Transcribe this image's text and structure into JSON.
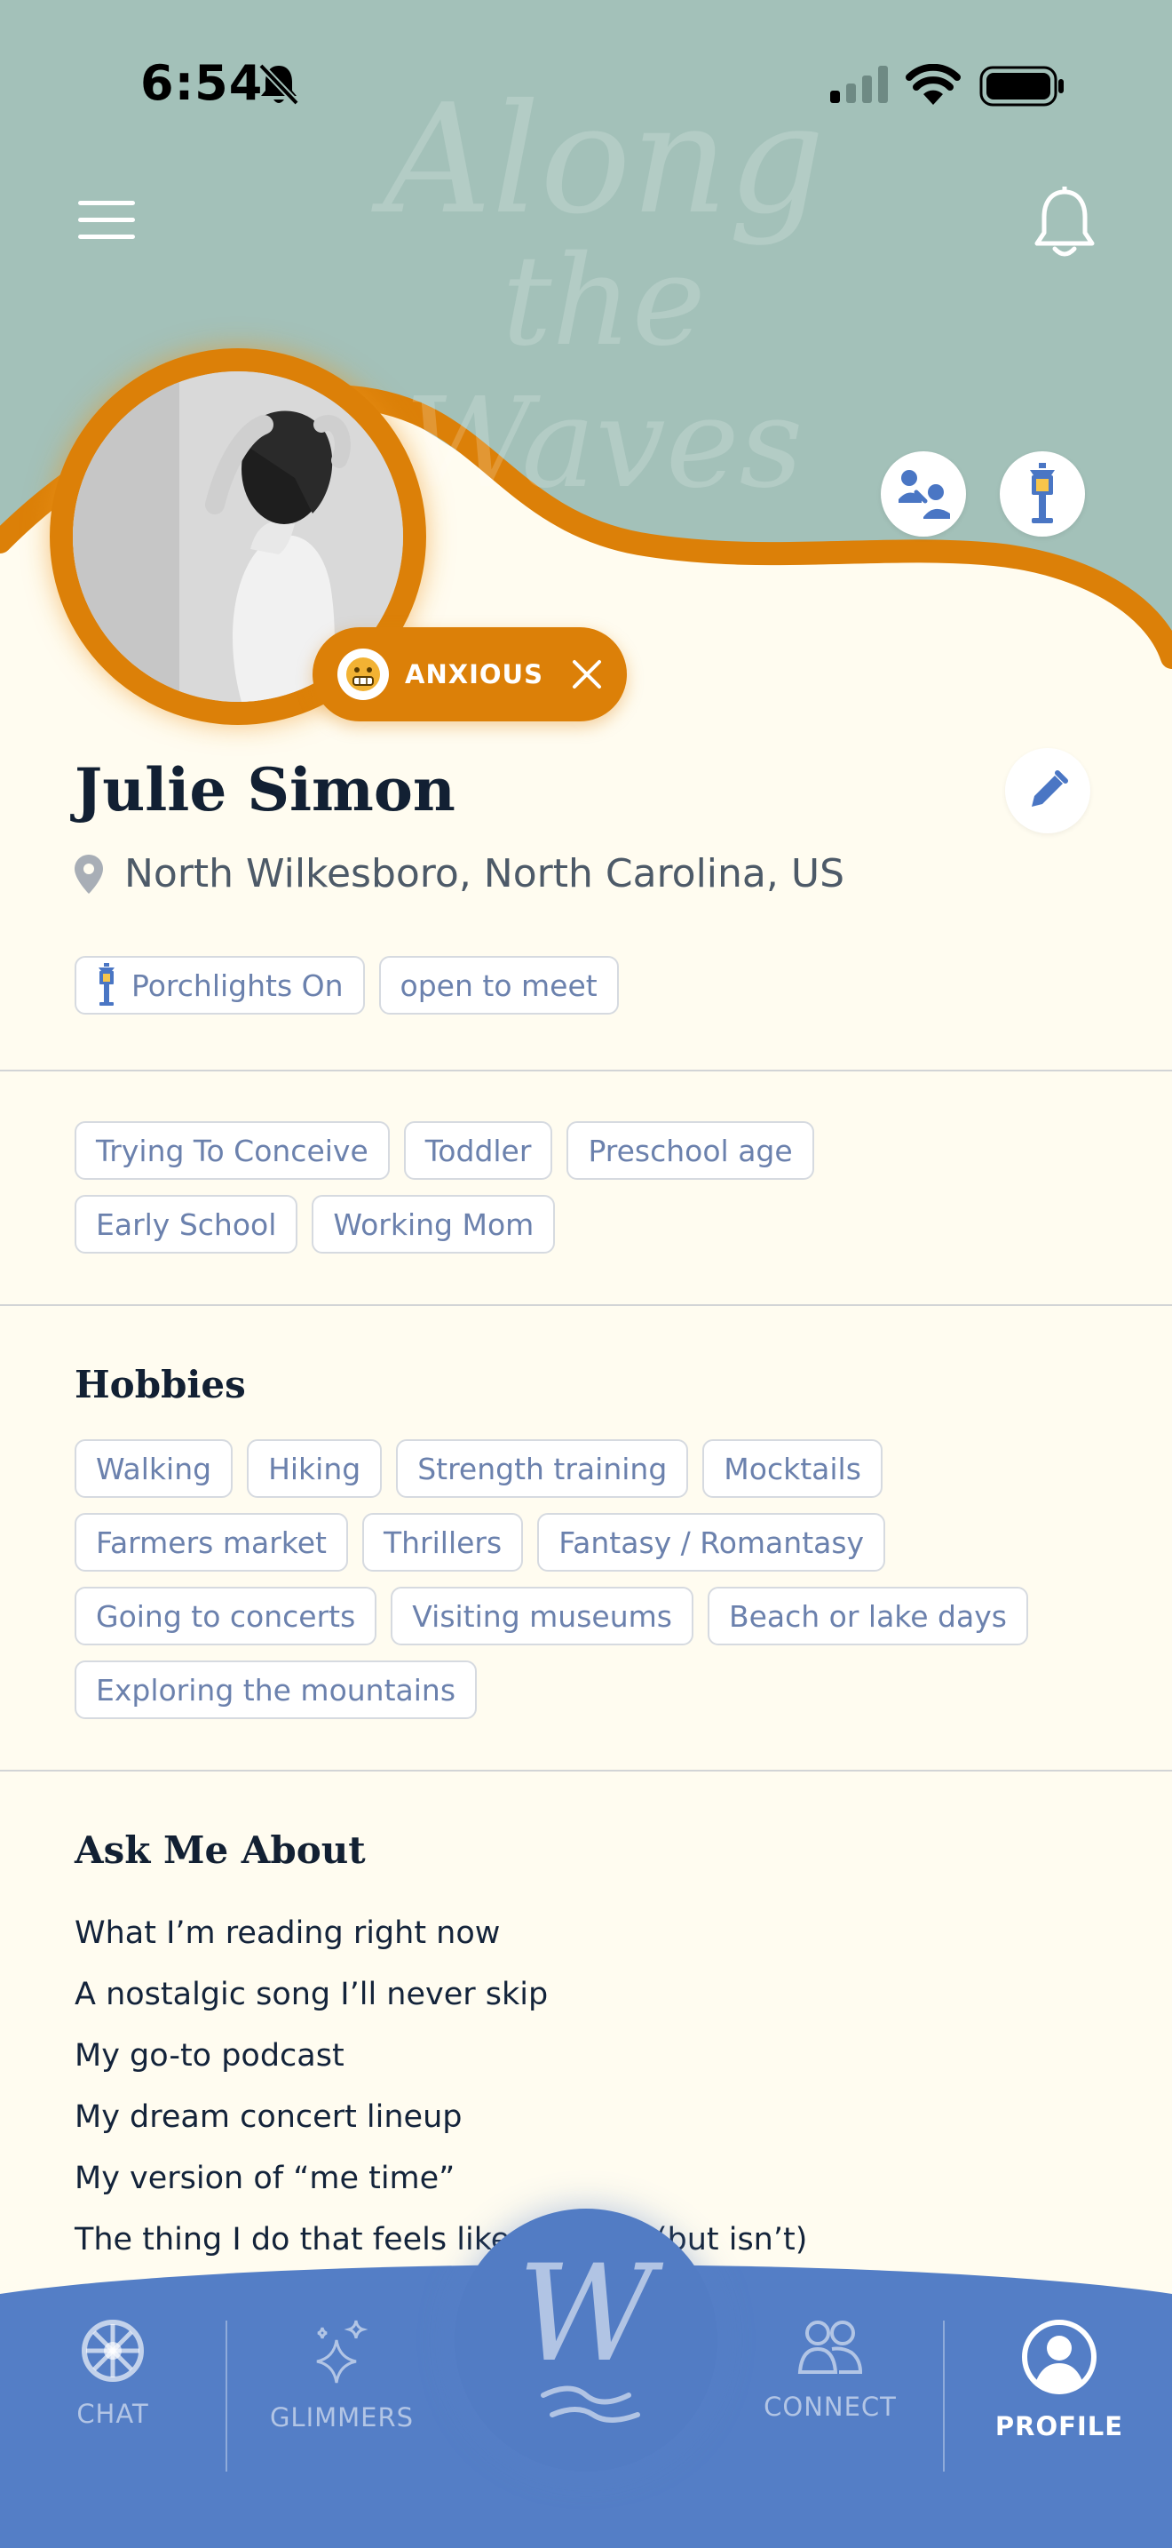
{
  "status_bar": {
    "time": "6:54"
  },
  "header": {
    "watermark_line1": "Along",
    "watermark_line2": "the Waves"
  },
  "profile": {
    "name": "Julie Simon",
    "location": "North Wilkesboro, North Carolina, US",
    "mood": "ANXIOUS",
    "status_tags": [
      "Porchlights On",
      "open to meet"
    ]
  },
  "stages": [
    "Trying To Conceive",
    "Toddler",
    "Preschool age",
    "Early School",
    "Working Mom"
  ],
  "hobbies": {
    "title": "Hobbies",
    "items": [
      "Walking",
      "Hiking",
      "Strength training",
      "Mocktails",
      "Farmers market",
      "Thrillers",
      "Fantasy / Romantasy",
      "Going to concerts",
      "Visiting museums",
      "Beach or lake days",
      "Exploring the mountains"
    ]
  },
  "ask_me_about": {
    "title": "Ask Me About",
    "items": [
      "What I’m reading right now",
      "A nostalgic song I’ll never skip",
      "My go-to podcast",
      "My dream concert lineup",
      "My version of “me time”",
      "The thing I do that feels like a hobby (but isn’t)"
    ]
  },
  "nav": {
    "chat": "CHAT",
    "glimmers": "GLIMMERS",
    "center_logo": "W",
    "connect": "CONNECT",
    "profile": "PROFILE",
    "active": "profile"
  },
  "colors": {
    "header_bg": "#A3C1B9",
    "accent_orange": "#DC8008",
    "page_bg": "#FFFCF0",
    "nav_bg": "#547EC6",
    "tag_text": "#6B81AD",
    "icon_blue": "#4A76C4"
  }
}
